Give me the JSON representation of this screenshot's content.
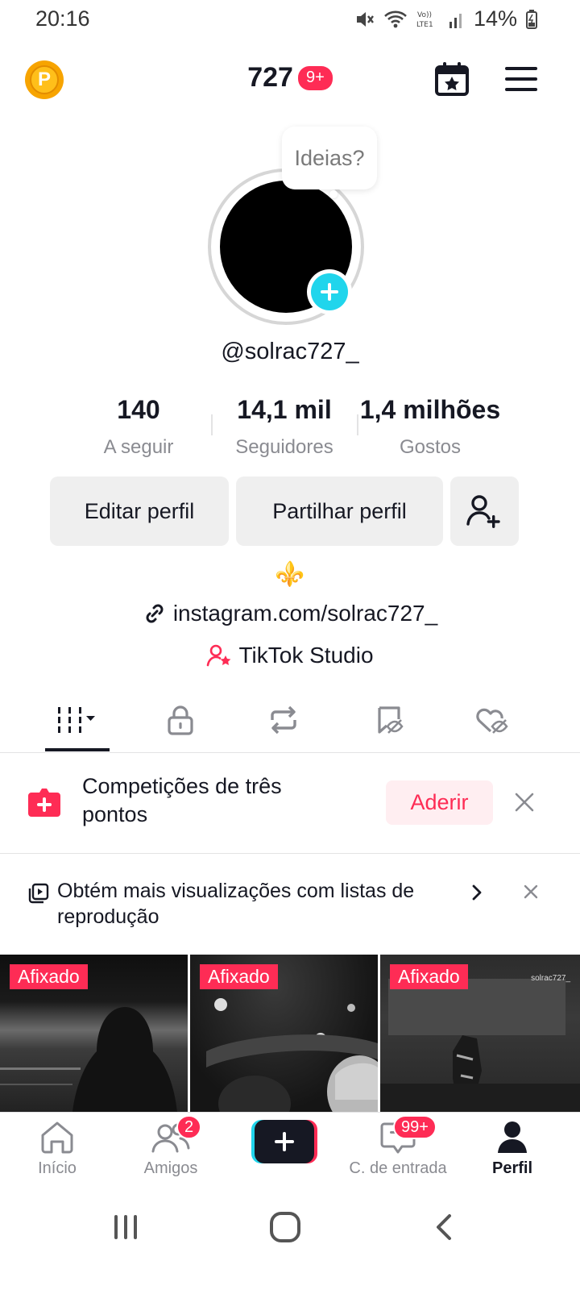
{
  "status_bar": {
    "time": "20:16",
    "battery": "14%",
    "network": "Vo)) LTE1"
  },
  "header": {
    "coin_label": "P",
    "title": "727",
    "badge": "9+"
  },
  "bubble": {
    "text": "Ideias?"
  },
  "profile": {
    "username": "@solrac727_"
  },
  "stats": [
    {
      "value": "140",
      "label": "A seguir"
    },
    {
      "value": "14,1 mil",
      "label": "Seguidores"
    },
    {
      "value": "1,4 milhões",
      "label": "Gostos"
    }
  ],
  "buttons": {
    "edit": "Editar perfil",
    "share": "Partilhar perfil"
  },
  "bio": {
    "emoji": "⚜️",
    "link": "instagram.com/solrac727_",
    "studio": "TikTok Studio"
  },
  "competition": {
    "text": "Competições de três pontos",
    "join": "Aderir"
  },
  "playlist": {
    "text": "Obtém mais visualizações com listas de reprodução"
  },
  "videos": [
    {
      "label": "Afixado"
    },
    {
      "label": "Afixado"
    },
    {
      "label": "Afixado",
      "watermark": "solrac727_"
    }
  ],
  "bottom_nav": {
    "home": "Início",
    "friends": "Amigos",
    "friends_badge": "2",
    "inbox": "C. de entrada",
    "inbox_badge": "99+",
    "profile": "Perfil"
  },
  "colors": {
    "accent": "#fe2c55",
    "cyan": "#20d5ec",
    "coin": "#f7a400"
  }
}
